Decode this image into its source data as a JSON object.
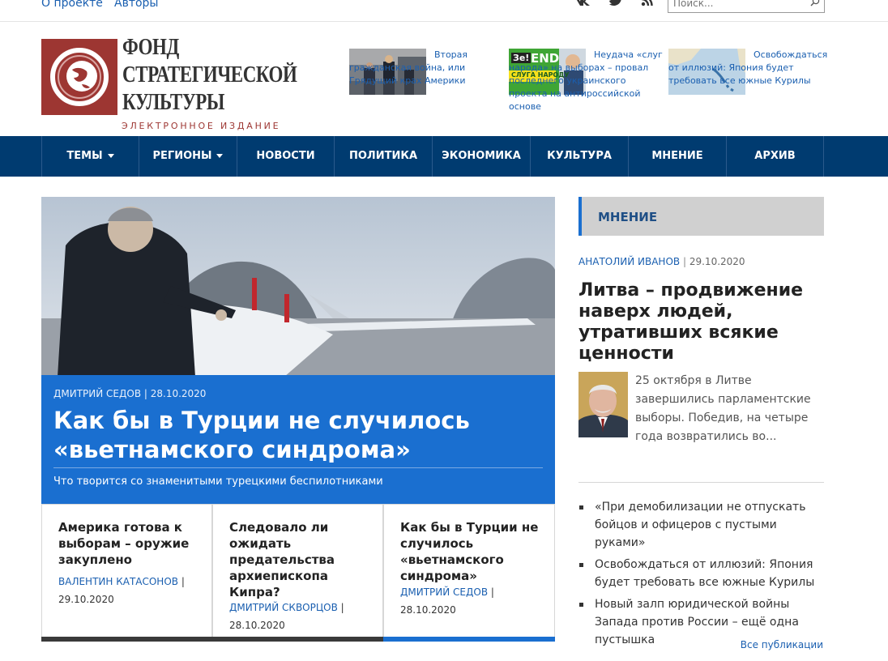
{
  "top": {
    "links": [
      "О проекте",
      "Авторы"
    ],
    "search_placeholder": "Поиск..."
  },
  "logo": {
    "line1": "ФОНД",
    "line2": "СТРАТЕГИЧЕСКОЙ",
    "line3": "КУЛЬТУРЫ",
    "subtitle": "ЭЛЕКТРОННОЕ ИЗДАНИЕ",
    "emblem_color": "#9d3632"
  },
  "teasers": [
    {
      "title": "Вторая гражданская война, или Грядущий крах Америки"
    },
    {
      "title": "Неудача «слуг народа» на выборах – провал последнего украинского проекта на антироссийской основе",
      "badge1": "Зе!",
      "badge2": "END",
      "badge3": "СЛУГА НАРОДУ"
    },
    {
      "title": "Освобождаться от иллюзий: Япония будет требовать все южные Курилы"
    }
  ],
  "nav": {
    "items": [
      "ТЕМЫ",
      "РЕГИОНЫ",
      "НОВОСТИ",
      "ПОЛИТИКА",
      "ЭКОНОМИКА",
      "КУЛЬТУРА",
      "МНЕНИЕ",
      "АРХИВ"
    ],
    "bg_color": "#003b70"
  },
  "feature": {
    "author": "ДМИТРИЙ СЕДОВ",
    "date": "28.10.2020",
    "title": "Как бы в Турции не случилось «вьетнамского синдрома»",
    "subtitle": "Что творится со знаменитыми турецкими беспилотниками",
    "box_color": "#1a6fd0"
  },
  "cards": [
    {
      "title": "Америка готова к выборам – оружие закуплено",
      "author": "ВАЛЕНТИН КАТАСОНОВ",
      "date": "29.10.2020",
      "bar": "#3a3a3a"
    },
    {
      "title": "Следовало ли ожидать предательства архиепископа Кипра?",
      "author": "ДМИТРИЙ СКВОРЦОВ",
      "date": "28.10.2020",
      "bar": "#3a3a3a"
    },
    {
      "title": "Как бы в Турции не случилось «вьетнамского синдрома»",
      "author": "ДМИТРИЙ СЕДОВ",
      "date": "28.10.2020",
      "bar": "#1a6fd0"
    }
  ],
  "sidebar": {
    "heading": "МНЕНИЕ",
    "author": "АНАТОЛИЙ ИВАНОВ",
    "date": "29.10.2020",
    "title": "Литва – продвижение наверх людей, утративших всякие ценности",
    "excerpt": "25 октября в Литве завершились парламентские выборы. Победив, на четыре года возвратились во...",
    "list": [
      "«При демобилизации не отпускать бойцов и офицеров с пустыми руками»",
      "Освобождаться от иллюзий: Япония будет требовать все южные Курилы",
      "Новый залп юридической войны Запада против России – ещё одна пустышка"
    ],
    "all_link": "Все публикации"
  }
}
